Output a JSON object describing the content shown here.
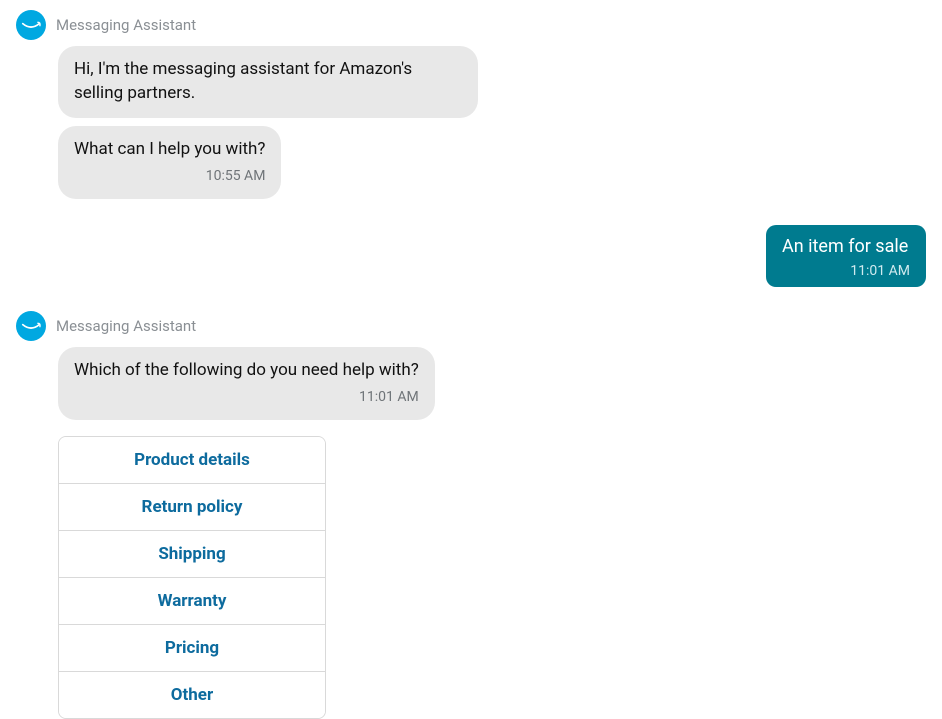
{
  "thread": {
    "bot_name": "Messaging Assistant",
    "bot_msg_1": "Hi, I'm the messaging assistant for Amazon's selling partners.",
    "bot_msg_2": "What can I help you with?",
    "bot_time_1": "10:55 AM",
    "user_msg_1": "An item for sale",
    "user_time_1": "11:01 AM",
    "bot_msg_3": "Which of the following do you need help with?",
    "bot_time_2": "11:01 AM"
  },
  "options": {
    "o0": "Product details",
    "o1": "Return policy",
    "o2": "Shipping",
    "o3": "Warranty",
    "o4": "Pricing",
    "o5": "Other"
  },
  "colors": {
    "avatar_bg": "#00a8e1",
    "user_bubble_bg": "#007b8f",
    "option_link": "#0d6b9e",
    "bot_bubble_bg": "#e8e8e8"
  }
}
